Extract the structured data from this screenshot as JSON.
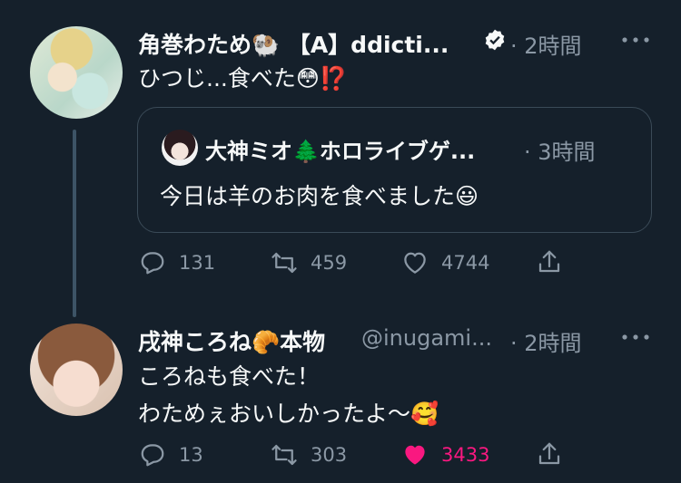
{
  "tweet1": {
    "display_name": "角巻わため🐏 【A】ddicti...",
    "time": "· 2時間",
    "text": "ひつじ...食べた😳⁉️",
    "quote": {
      "display_name": "大神ミオ🌲ホロライブゲ...",
      "time": "· 3時間",
      "text": "今日は羊のお肉を食べました😃"
    },
    "replies": "131",
    "retweets": "459",
    "likes": "4744"
  },
  "tweet2": {
    "display_name": "戌神ころね🥐本物",
    "handle": "@inugami...",
    "time": "· 2時間",
    "text_line1": "ころねも食べた！",
    "text_line2": "わためぇおいしかったよ〜🥰",
    "replies": "13",
    "retweets": "303",
    "likes": "3433",
    "liked": true
  },
  "icons": {
    "more": "more-icon",
    "reply": "reply-icon",
    "retweet": "retweet-icon",
    "like": "heart-icon",
    "share": "share-icon",
    "verified": "verified-badge-icon"
  },
  "colors": {
    "background": "#15202b",
    "like_active": "#f91880",
    "muted": "#8b98a5"
  }
}
